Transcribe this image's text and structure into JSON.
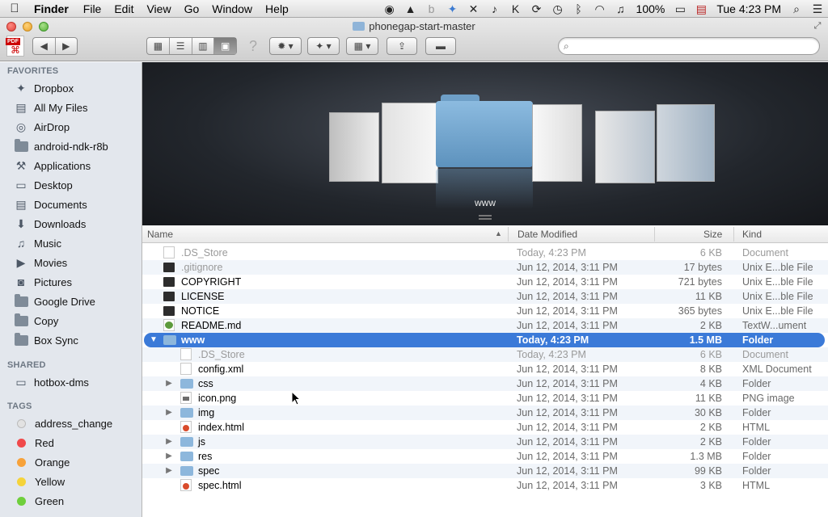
{
  "menubar": {
    "app": "Finder",
    "menus": [
      "File",
      "Edit",
      "View",
      "Go",
      "Window",
      "Help"
    ],
    "battery": "100%",
    "clock": "Tue 4:23 PM"
  },
  "window": {
    "title": "phonegap-start-master"
  },
  "sidebar": {
    "favorites_header": "FAVORITES",
    "favorites": [
      {
        "label": "Dropbox",
        "icon": "dropbox-icon"
      },
      {
        "label": "All My Files",
        "icon": "all-files-icon"
      },
      {
        "label": "AirDrop",
        "icon": "airdrop-icon"
      },
      {
        "label": "android-ndk-r8b",
        "icon": "folder-icon"
      },
      {
        "label": "Applications",
        "icon": "applications-icon"
      },
      {
        "label": "Desktop",
        "icon": "desktop-icon"
      },
      {
        "label": "Documents",
        "icon": "documents-icon"
      },
      {
        "label": "Downloads",
        "icon": "downloads-icon"
      },
      {
        "label": "Music",
        "icon": "music-icon"
      },
      {
        "label": "Movies",
        "icon": "movies-icon"
      },
      {
        "label": "Pictures",
        "icon": "pictures-icon"
      },
      {
        "label": "Google Drive",
        "icon": "folder-icon"
      },
      {
        "label": "Copy",
        "icon": "folder-icon"
      },
      {
        "label": "Box Sync",
        "icon": "folder-icon"
      }
    ],
    "shared_header": "SHARED",
    "shared": [
      {
        "label": "hotbox-dms",
        "icon": "computer-icon"
      }
    ],
    "tags_header": "TAGS",
    "tags": [
      {
        "label": "address_change",
        "color": "#e2e2e2"
      },
      {
        "label": "Red",
        "color": "#f0494a"
      },
      {
        "label": "Orange",
        "color": "#f7a23a"
      },
      {
        "label": "Yellow",
        "color": "#f5d33a"
      },
      {
        "label": "Green",
        "color": "#6fcf3c"
      }
    ]
  },
  "coverflow": {
    "selected_label": "www"
  },
  "list": {
    "columns": {
      "name": "Name",
      "date": "Date Modified",
      "size": "Size",
      "kind": "Kind"
    },
    "rows": [
      {
        "name": ".DS_Store",
        "date": "Today, 4:23 PM",
        "size": "6 KB",
        "kind": "Document",
        "icon": "doc",
        "level": 0,
        "disclosure": "",
        "dim": true
      },
      {
        "name": ".gitignore",
        "date": "Jun 12, 2014, 3:11 PM",
        "size": "17 bytes",
        "kind": "Unix E...ble File",
        "icon": "exe",
        "level": 0,
        "disclosure": "",
        "dim": false,
        "nameDim": true
      },
      {
        "name": "COPYRIGHT",
        "date": "Jun 12, 2014, 3:11 PM",
        "size": "721 bytes",
        "kind": "Unix E...ble File",
        "icon": "exe",
        "level": 0,
        "disclosure": ""
      },
      {
        "name": "LICENSE",
        "date": "Jun 12, 2014, 3:11 PM",
        "size": "11 KB",
        "kind": "Unix E...ble File",
        "icon": "exe",
        "level": 0,
        "disclosure": ""
      },
      {
        "name": "NOTICE",
        "date": "Jun 12, 2014, 3:11 PM",
        "size": "365 bytes",
        "kind": "Unix E...ble File",
        "icon": "exe",
        "level": 0,
        "disclosure": ""
      },
      {
        "name": "README.md",
        "date": "Jun 12, 2014, 3:11 PM",
        "size": "2 KB",
        "kind": "TextW...ument",
        "icon": "md",
        "level": 0,
        "disclosure": ""
      },
      {
        "name": "www",
        "date": "Today, 4:23 PM",
        "size": "1.5 MB",
        "kind": "Folder",
        "icon": "folder",
        "level": 0,
        "disclosure": "▼",
        "selected": true
      },
      {
        "name": ".DS_Store",
        "date": "Today, 4:23 PM",
        "size": "6 KB",
        "kind": "Document",
        "icon": "doc",
        "level": 1,
        "disclosure": "",
        "dim": true
      },
      {
        "name": "config.xml",
        "date": "Jun 12, 2014, 3:11 PM",
        "size": "8 KB",
        "kind": "XML Document",
        "icon": "doc",
        "level": 1,
        "disclosure": ""
      },
      {
        "name": "css",
        "date": "Jun 12, 2014, 3:11 PM",
        "size": "4 KB",
        "kind": "Folder",
        "icon": "folder",
        "level": 1,
        "disclosure": "▶"
      },
      {
        "name": "icon.png",
        "date": "Jun 12, 2014, 3:11 PM",
        "size": "11 KB",
        "kind": "PNG image",
        "icon": "img",
        "level": 1,
        "disclosure": ""
      },
      {
        "name": "img",
        "date": "Jun 12, 2014, 3:11 PM",
        "size": "30 KB",
        "kind": "Folder",
        "icon": "folder",
        "level": 1,
        "disclosure": "▶"
      },
      {
        "name": "index.html",
        "date": "Jun 12, 2014, 3:11 PM",
        "size": "2 KB",
        "kind": "HTML",
        "icon": "html",
        "level": 1,
        "disclosure": ""
      },
      {
        "name": "js",
        "date": "Jun 12, 2014, 3:11 PM",
        "size": "2 KB",
        "kind": "Folder",
        "icon": "folder",
        "level": 1,
        "disclosure": "▶"
      },
      {
        "name": "res",
        "date": "Jun 12, 2014, 3:11 PM",
        "size": "1.3 MB",
        "kind": "Folder",
        "icon": "folder",
        "level": 1,
        "disclosure": "▶"
      },
      {
        "name": "spec",
        "date": "Jun 12, 2014, 3:11 PM",
        "size": "99 KB",
        "kind": "Folder",
        "icon": "folder",
        "level": 1,
        "disclosure": "▶"
      },
      {
        "name": "spec.html",
        "date": "Jun 12, 2014, 3:11 PM",
        "size": "3 KB",
        "kind": "HTML",
        "icon": "html",
        "level": 1,
        "disclosure": ""
      }
    ]
  }
}
